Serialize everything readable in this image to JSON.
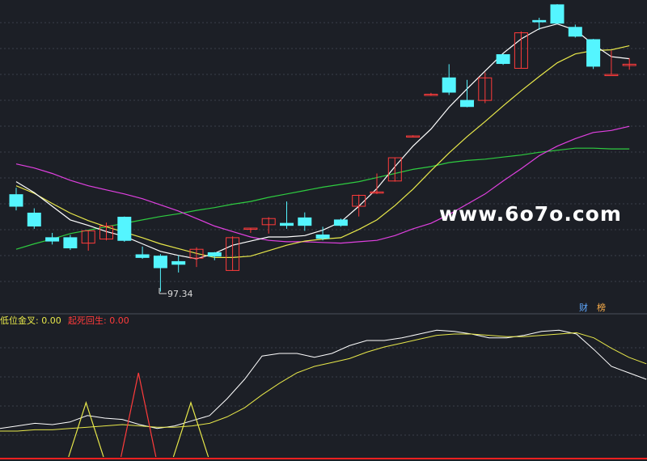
{
  "colors": {
    "background": "#1c1f26",
    "up": "#ff3b3b",
    "down": "#54f5ff",
    "ma_white": "#ffffff",
    "ma_yellow": "#e8e84a",
    "ma_magenta": "#e040e0",
    "ma_green": "#2ecc40",
    "grid": "#3a3f4a"
  },
  "watermark": "www.6o7o.com",
  "low_marker": "97.34",
  "badges": {
    "cai": "财",
    "bang": "榜"
  },
  "indicator": {
    "label1_name": "低位金叉",
    "label1_value": "0.00",
    "label2_name": "起死回生",
    "label2_value": "0.00"
  },
  "chart_data": [
    {
      "type": "candlestick",
      "title": "",
      "ylim": [
        95.0,
        125.0
      ],
      "candles": [
        {
          "o": 111.5,
          "h": 112.5,
          "l": 109.2,
          "c": 109.8
        },
        {
          "o": 108.8,
          "h": 109.5,
          "l": 106.5,
          "c": 106.9
        },
        {
          "o": 105.2,
          "h": 105.9,
          "l": 104.2,
          "c": 104.7
        },
        {
          "o": 105.2,
          "h": 105.6,
          "l": 103.4,
          "c": 103.7
        },
        {
          "o": 104.4,
          "h": 106.3,
          "l": 103.3,
          "c": 106.2
        },
        {
          "o": 105.0,
          "h": 107.4,
          "l": 104.8,
          "c": 106.9
        },
        {
          "o": 108.2,
          "h": 108.3,
          "l": 104.6,
          "c": 104.8
        },
        {
          "o": 102.7,
          "h": 103.9,
          "l": 102.1,
          "c": 102.3
        },
        {
          "o": 102.5,
          "h": 102.8,
          "l": 97.3,
          "c": 100.8
        },
        {
          "o": 101.7,
          "h": 102.6,
          "l": 100.1,
          "c": 101.3
        },
        {
          "o": 102.2,
          "h": 103.8,
          "l": 100.9,
          "c": 103.5
        },
        {
          "o": 103.0,
          "h": 103.1,
          "l": 101.9,
          "c": 102.5
        },
        {
          "o": 100.4,
          "h": 105.4,
          "l": 100.4,
          "c": 105.2
        },
        {
          "o": 106.5,
          "h": 106.6,
          "l": 105.9,
          "c": 106.6
        },
        {
          "o": 107.1,
          "h": 108.2,
          "l": 105.8,
          "c": 108.0
        },
        {
          "o": 107.3,
          "h": 110.5,
          "l": 106.5,
          "c": 107.0
        },
        {
          "o": 108.1,
          "h": 108.9,
          "l": 106.2,
          "c": 107.0
        },
        {
          "o": 105.6,
          "h": 106.8,
          "l": 104.8,
          "c": 105.1
        },
        {
          "o": 107.8,
          "h": 108.0,
          "l": 106.8,
          "c": 107.0
        },
        {
          "o": 109.8,
          "h": 111.5,
          "l": 108.3,
          "c": 111.4
        },
        {
          "o": 111.8,
          "h": 114.6,
          "l": 111.6,
          "c": 111.9
        },
        {
          "o": 113.5,
          "h": 116.9,
          "l": 113.4,
          "c": 116.9
        },
        {
          "o": 120.1,
          "h": 120.2,
          "l": 120.0,
          "c": 120.1
        },
        {
          "o": 126.2,
          "h": 126.4,
          "l": 126.0,
          "c": 126.2
        },
        {
          "o": 128.6,
          "h": 130.6,
          "l": 126.1,
          "c": 126.5
        },
        {
          "o": 125.3,
          "h": 128.3,
          "l": 124.3,
          "c": 124.4
        },
        {
          "o": 125.3,
          "h": 129.4,
          "l": 124.9,
          "c": 128.6
        },
        {
          "o": 132.0,
          "h": 132.1,
          "l": 130.5,
          "c": 130.7
        },
        {
          "o": 130.0,
          "h": 135.4,
          "l": 130.0,
          "c": 135.2
        },
        {
          "o": 137.0,
          "h": 137.4,
          "l": 135.6,
          "c": 136.8
        },
        {
          "o": 139.3,
          "h": 139.4,
          "l": 136.5,
          "c": 136.6
        },
        {
          "o": 136.0,
          "h": 136.4,
          "l": 134.5,
          "c": 134.7
        },
        {
          "o": 134.2,
          "h": 134.3,
          "l": 129.9,
          "c": 130.3
        },
        {
          "o": 129.1,
          "h": 132.6,
          "l": 129.1,
          "c": 129.1
        },
        {
          "o": 130.4,
          "h": 131.5,
          "l": 129.8,
          "c": 130.6
        }
      ],
      "ma_white": [
        113.4,
        111.8,
        109.8,
        107.8,
        107.0,
        106.1,
        105.4,
        104.3,
        103.2,
        102.6,
        102.1,
        102.9,
        104.1,
        104.7,
        105.3,
        105.3,
        105.5,
        106.3,
        107.5,
        109.8,
        112.4,
        115.6,
        118.6,
        121.1,
        124.3,
        127.0,
        129.6,
        132.2,
        134.3,
        135.8,
        136.5,
        135.6,
        133.5,
        131.7,
        131.4
      ],
      "ma_yellow": [
        112.8,
        111.7,
        110.2,
        108.8,
        107.7,
        106.8,
        106.0,
        105.2,
        104.3,
        103.6,
        102.9,
        102.3,
        102.3,
        102.5,
        103.3,
        104.1,
        104.7,
        105.0,
        105.2,
        106.4,
        107.8,
        109.9,
        112.3,
        115.0,
        117.6,
        120.0,
        122.2,
        124.5,
        126.7,
        128.8,
        130.8,
        132.1,
        132.6,
        132.7,
        133.3
      ],
      "ma_magenta": [
        116.0,
        115.4,
        114.6,
        113.6,
        112.8,
        112.2,
        111.6,
        110.9,
        110.0,
        109.1,
        108.0,
        106.9,
        106.1,
        105.3,
        104.8,
        104.6,
        104.6,
        104.5,
        104.4,
        104.6,
        104.8,
        105.5,
        106.5,
        107.3,
        108.6,
        110.1,
        111.6,
        113.5,
        115.3,
        117.2,
        118.6,
        119.7,
        120.6,
        120.9,
        121.5
      ],
      "ma_green": [
        103.5,
        104.3,
        105.0,
        105.8,
        106.3,
        106.8,
        107.3,
        107.8,
        108.3,
        108.7,
        109.2,
        109.6,
        110.1,
        110.5,
        111.1,
        111.6,
        112.1,
        112.6,
        113.0,
        113.4,
        114.0,
        114.6,
        115.2,
        115.6,
        116.2,
        116.5,
        116.7,
        117.0,
        117.3,
        117.7,
        118.0,
        118.3,
        118.3,
        118.2,
        118.2
      ]
    },
    {
      "type": "line",
      "title": "",
      "ylim": [
        0,
        100
      ],
      "series": [
        {
          "values": [
            22,
            24,
            26,
            25,
            27,
            32,
            30,
            29,
            25,
            22,
            24,
            28,
            32,
            45,
            60,
            78,
            80,
            80,
            77,
            80,
            86,
            90,
            90,
            92,
            95,
            98,
            97,
            95,
            92,
            92,
            94,
            97,
            98,
            95,
            83,
            70,
            65,
            60
          ]
        },
        {
          "values": [
            20,
            20,
            21,
            21,
            22,
            23,
            24,
            25,
            24,
            23,
            23,
            24,
            26,
            31,
            38,
            48,
            57,
            65,
            70,
            73,
            76,
            81,
            85,
            88,
            91,
            94,
            95,
            95,
            94,
            93,
            93,
            94,
            95,
            96,
            92,
            84,
            77,
            72
          ]
        }
      ],
      "signal_triangles": [
        {
          "start_index": 3,
          "end_index": 5,
          "peak": 42
        },
        {
          "start_index": 6,
          "end_index": 8,
          "peak": 65
        },
        {
          "start_index": 9,
          "end_index": 11,
          "peak": 42
        }
      ]
    }
  ]
}
